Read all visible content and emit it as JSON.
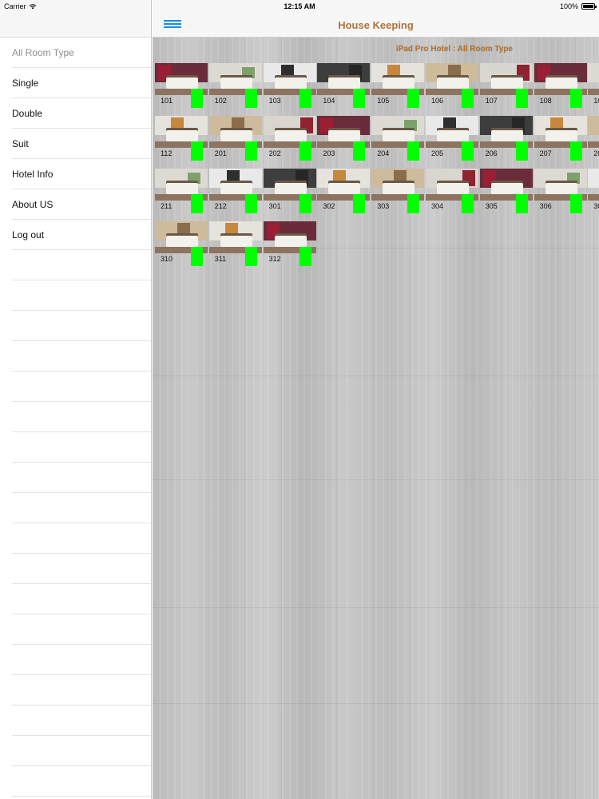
{
  "status_bar": {
    "carrier": "Carrier",
    "time": "12:15 AM",
    "battery": "100%"
  },
  "sidebar": {
    "items": [
      {
        "label": "All Room Type",
        "selected": true
      },
      {
        "label": "Single",
        "selected": false
      },
      {
        "label": "Double",
        "selected": false
      },
      {
        "label": "Suit",
        "selected": false
      },
      {
        "label": "Hotel Info",
        "selected": false
      },
      {
        "label": "About US",
        "selected": false
      },
      {
        "label": "Log out",
        "selected": false
      }
    ]
  },
  "header": {
    "title": "House Keeping",
    "menu_icon": "hamburger-icon"
  },
  "subtitle": "iPad Pro Hotel : All Room Type",
  "rooms": [
    {
      "number": "101",
      "style": 0
    },
    {
      "number": "102",
      "style": 1
    },
    {
      "number": "103",
      "style": 2
    },
    {
      "number": "104",
      "style": 3
    },
    {
      "number": "105",
      "style": 4
    },
    {
      "number": "106",
      "style": 5
    },
    {
      "number": "107",
      "style": 6
    },
    {
      "number": "108",
      "style": 0
    },
    {
      "number": "10",
      "style": 1
    },
    {
      "number": "112",
      "style": 4
    },
    {
      "number": "201",
      "style": 5
    },
    {
      "number": "202",
      "style": 6
    },
    {
      "number": "203",
      "style": 0
    },
    {
      "number": "204",
      "style": 1
    },
    {
      "number": "205",
      "style": 2
    },
    {
      "number": "206",
      "style": 3
    },
    {
      "number": "207",
      "style": 4
    },
    {
      "number": "20",
      "style": 5
    },
    {
      "number": "211",
      "style": 1
    },
    {
      "number": "212",
      "style": 2
    },
    {
      "number": "301",
      "style": 3
    },
    {
      "number": "302",
      "style": 4
    },
    {
      "number": "303",
      "style": 5
    },
    {
      "number": "304",
      "style": 6
    },
    {
      "number": "305",
      "style": 0
    },
    {
      "number": "306",
      "style": 1
    },
    {
      "number": "30",
      "style": 2
    },
    {
      "number": "310",
      "style": 5
    },
    {
      "number": "311",
      "style": 4
    },
    {
      "number": "312",
      "style": 0
    }
  ],
  "colors": {
    "accent": "#1a8be8",
    "title": "#b1733a",
    "status_clean": "#00ff00"
  }
}
